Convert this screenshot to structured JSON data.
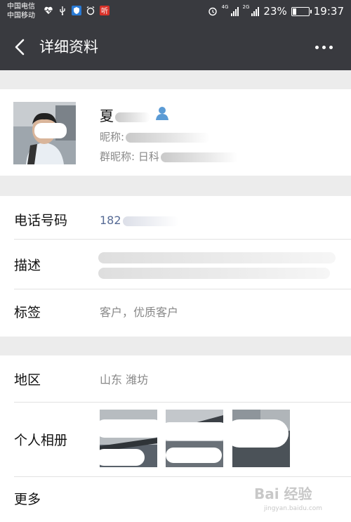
{
  "status_bar": {
    "carrier1": "中国电信",
    "carrier2": "中国移动",
    "network_tag": "4G",
    "network_tag2": "2G",
    "battery": "23%",
    "time": "19:37",
    "battery_level": 0.23,
    "left_icons": [
      "heart-rate-icon",
      "usb-icon",
      "shield-app-icon",
      "alarm-app-icon",
      "ting-app-icon"
    ],
    "right_icons": [
      "alarm-clock-icon",
      "signal-icon",
      "battery-icon"
    ]
  },
  "nav": {
    "title": "详细资料",
    "back_icon": "back-chevron-icon",
    "more_icon": "more-dots-icon"
  },
  "profile": {
    "name": "夏",
    "gender_icon": "male-user-icon",
    "nickname_label": "昵称:",
    "group_nickname_label": "群昵称: 日科"
  },
  "rows": {
    "phone": {
      "label": "电话号码",
      "value": "182"
    },
    "description": {
      "label": "描述"
    },
    "tags": {
      "label": "标签",
      "value": "客户，优质客户"
    },
    "region": {
      "label": "地区",
      "value": "山东  潍坊"
    },
    "album": {
      "label": "个人相册"
    },
    "more": {
      "label": "更多"
    }
  },
  "watermark": {
    "text": "Bai 经验",
    "sub": "jingyan.baidu.com"
  },
  "colors": {
    "header_bg": "#393a3f",
    "link": "#576b95",
    "gray_text": "#888888",
    "page_bg": "#ececec",
    "gender_icon": "#5b9bd5"
  }
}
